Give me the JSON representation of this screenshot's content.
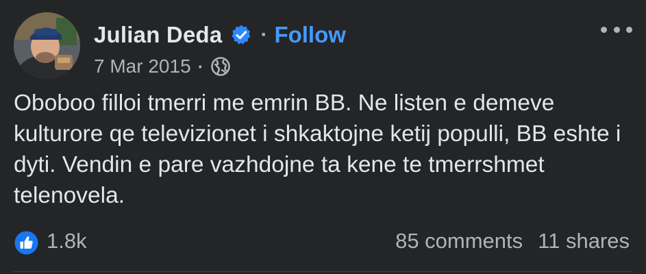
{
  "post": {
    "author": {
      "name": "Julian Deda",
      "verified": true,
      "follow_label": "Follow"
    },
    "separator": "·",
    "date": "7 Mar 2015",
    "audience_icon": "globe-icon",
    "more_icon": "more-options-icon",
    "text": "Oboboo filloi tmerri me emrin BB. Ne listen e demeve kulturore qe televizionet i shkaktojne ketij populli, BB eshte i dyti. Vendin e pare vazhdojne ta kene te tmerrshmet telenovela.",
    "reactions": {
      "icon": "like-icon",
      "count": "1.8k"
    },
    "comments": "85 comments",
    "shares": "11 shares"
  },
  "colors": {
    "background": "#242526",
    "primary_text": "#e4e6eb",
    "secondary_text": "#b0b3b8",
    "link": "#4599ff",
    "like_blue": "#1877f2",
    "verified_blue": "#2d88ff"
  }
}
